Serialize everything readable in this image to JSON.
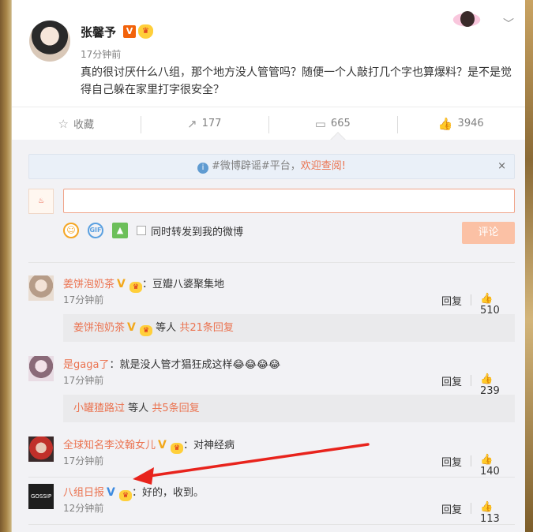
{
  "post": {
    "author": "张馨予",
    "verified_mark": "V",
    "time": "17分钟前",
    "text": "真的很讨厌什么八组，那个地方没人管管吗？随便一个人敲打几个字也算爆料？是不是觉得自己躲在家里打字很安全？",
    "actions": {
      "favorite_label": "收藏",
      "repost_count": "177",
      "comment_count": "665",
      "like_count": "3946"
    }
  },
  "comment_box": {
    "notice_prefix": "#微博辟谣#平台，",
    "notice_link": "欢迎查阅!",
    "notice_close": "×",
    "repost_label": "同时转发到我的微博",
    "submit_label": "评论",
    "input_value": ""
  },
  "comments": [
    {
      "user": "姜饼泡奶茶",
      "text": "：豆瓣八婆聚集地",
      "time": "17分钟前",
      "reply_label": "回复",
      "likes": "510",
      "sub": {
        "users": "姜饼泡奶茶",
        "others": "等人",
        "count_text": "共21条回复"
      }
    },
    {
      "user": "是gaga了",
      "text": "：就是没人管才猖狂成这样",
      "emoji": "😂😂😂😂",
      "time": "17分钟前",
      "reply_label": "回复",
      "likes": "239",
      "sub": {
        "users": "小罐猹路过",
        "others": "等人",
        "count_text": "共5条回复"
      }
    },
    {
      "user": "全球知名李汶翰女儿",
      "text": "：对神经病",
      "time": "17分钟前",
      "reply_label": "回复",
      "likes": "140"
    },
    {
      "user": "八组日报",
      "text": "：好的，收到。",
      "time": "12分钟前",
      "reply_label": "回复",
      "likes": "113",
      "avatar_text": "GOSSIP"
    }
  ],
  "colors": {
    "accent": "#eb7350",
    "annotation_arrow": "#e8231c",
    "verified_orange": "#f2620a",
    "verified_blue": "#3d8ae0"
  }
}
